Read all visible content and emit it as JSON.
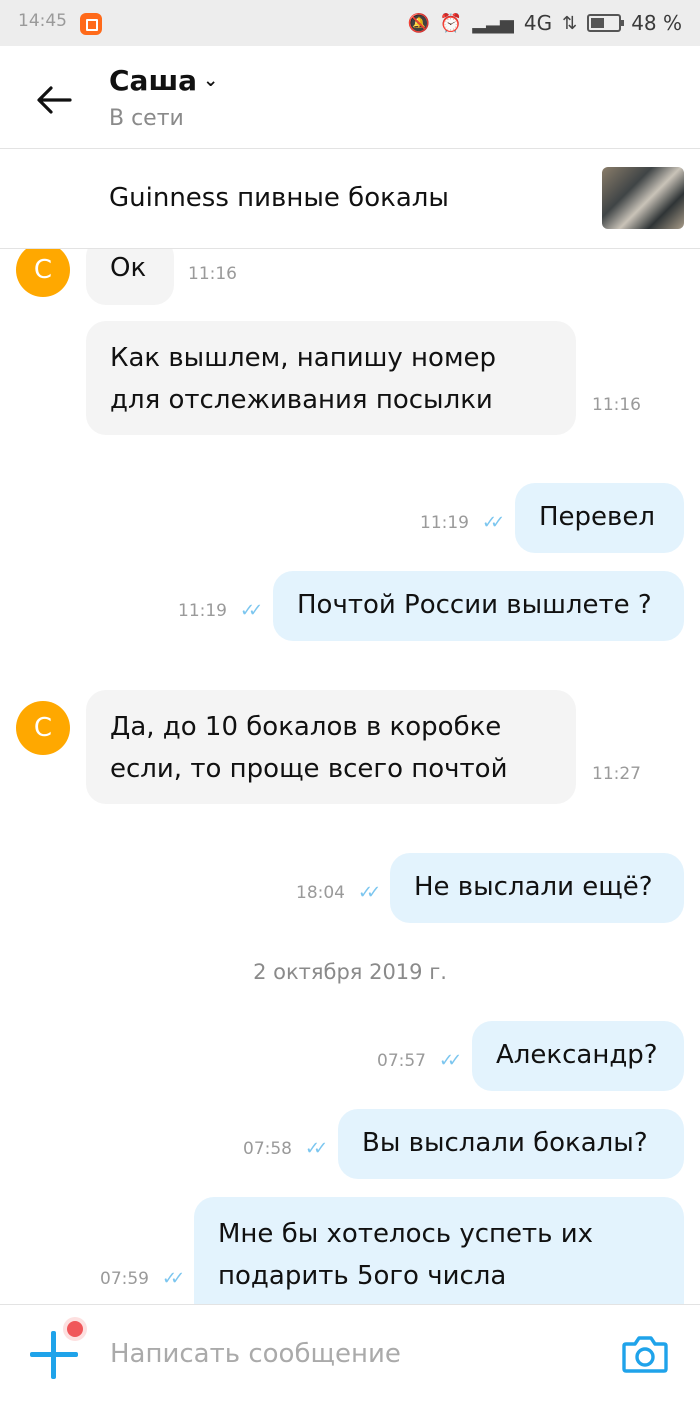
{
  "status_bar": {
    "time": "14:45",
    "network": "4G",
    "battery": "48 %",
    "battery_level": 0.48
  },
  "header": {
    "contact_name": "Саша",
    "status": "В сети"
  },
  "listing": {
    "title": "Guinness пивные бокалы"
  },
  "messages": [
    {
      "dir": "in",
      "text": "Ок",
      "time": "11:16"
    },
    {
      "dir": "in",
      "lines": [
        "Как вышлем, напишу номер",
        "для отслеживания посылки"
      ],
      "time": "11:16"
    },
    {
      "dir": "out",
      "text": "Перевел",
      "time": "11:19"
    },
    {
      "dir": "out",
      "text": "Почтой России вышлете ?",
      "time": "11:19"
    },
    {
      "dir": "in",
      "lines": [
        "Да, до 10 бокалов в коробке",
        "если, то проще всего почтой"
      ],
      "time": "11:27"
    },
    {
      "dir": "out",
      "text": "Не выслали ещё?",
      "time": "18:04"
    },
    {
      "dir": "out",
      "text": "Александр?",
      "time": "07:57"
    },
    {
      "dir": "out",
      "text": "Вы выслали бокалы?",
      "time": "07:58"
    },
    {
      "dir": "out",
      "lines": [
        "Мне бы хотелось успеть их",
        "подарить 5ого числа"
      ],
      "time": "07:59"
    }
  ],
  "avatar_letter": "С",
  "date_separator": "2 октября 2019 г.",
  "read_ticks": "✓✓",
  "composer": {
    "placeholder": "Написать сообщение"
  },
  "colors": {
    "accent": "#1fa3ea",
    "avatar": "#ffa800",
    "incoming_bubble": "#f4f4f4",
    "outgoing_bubble": "#e3f3fd"
  }
}
